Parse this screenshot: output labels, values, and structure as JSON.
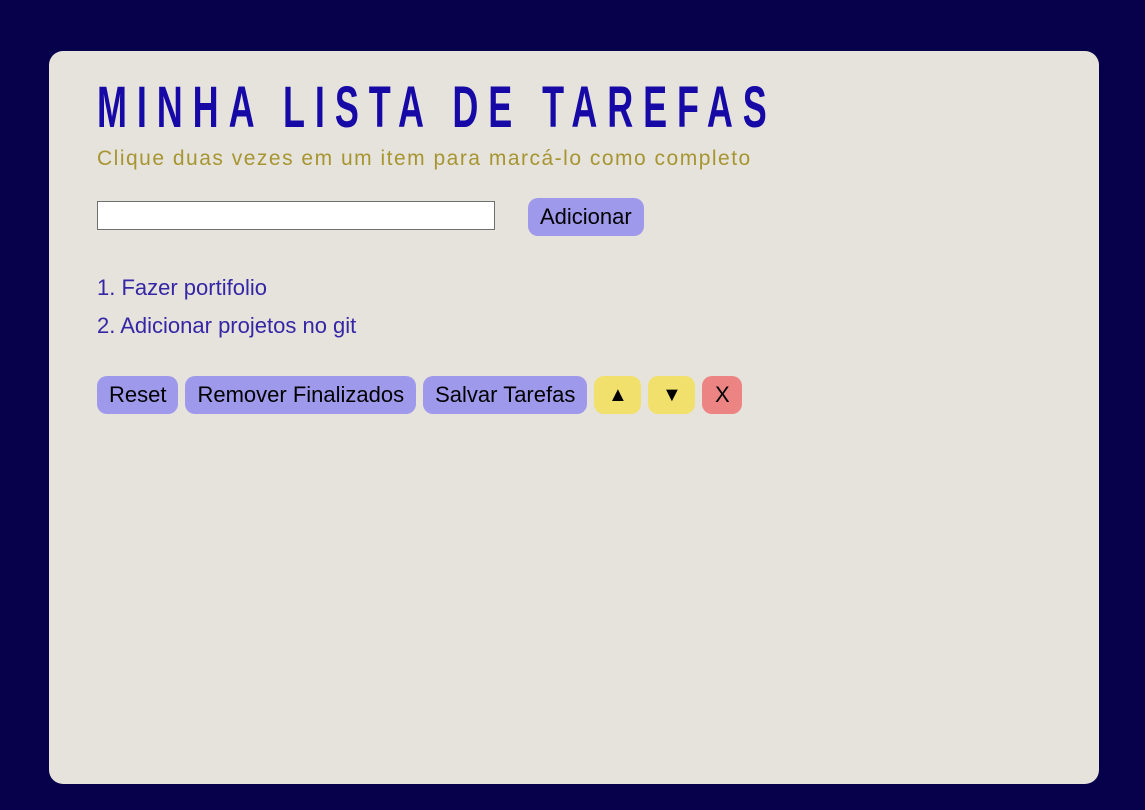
{
  "header": {
    "title": "MINHA LISTA DE TAREFAS",
    "subtitle": "Clique duas vezes em um item para marcá-lo como completo"
  },
  "form": {
    "input_value": "",
    "placeholder": "",
    "add_label": "Adicionar"
  },
  "tasks": [
    {
      "text": "1. Fazer portifolio"
    },
    {
      "text": "2. Adicionar projetos no git"
    }
  ],
  "toolbar": {
    "reset_label": "Reset",
    "remove_done_label": "Remover Finalizados",
    "save_label": "Salvar Tarefas",
    "up_label": "▲",
    "down_label": "▼",
    "delete_label": "X"
  },
  "colors": {
    "page_background": "#07004a",
    "card_background": "#e6e3dc",
    "title": "#1609a6",
    "subtitle": "#a69531",
    "task_text": "#3526a6",
    "button_purple": "#9f99ec",
    "button_yellow": "#f2e06c",
    "button_red": "#ec8484"
  },
  "icons": {
    "up": "arrow-up-icon",
    "down": "arrow-down-icon"
  }
}
